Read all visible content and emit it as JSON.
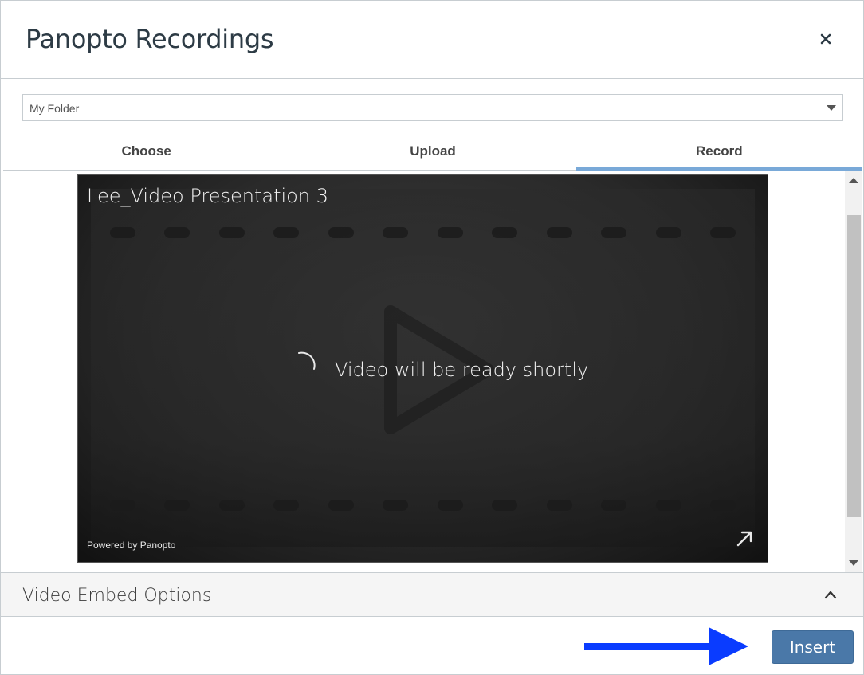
{
  "dialog": {
    "title": "Panopto Recordings",
    "close_icon": "close-icon"
  },
  "folder_select": {
    "value": "My Folder"
  },
  "tabs": [
    {
      "label": "Choose",
      "active": false
    },
    {
      "label": "Upload",
      "active": false
    },
    {
      "label": "Record",
      "active": true
    }
  ],
  "player": {
    "video_title": "Lee_Video Presentation 3",
    "status": "Video will be ready shortly",
    "powered_by": "Powered by Panopto"
  },
  "embed_options": {
    "title": "Video Embed Options"
  },
  "footer": {
    "insert_label": "Insert"
  },
  "colors": {
    "active_tab_underline": "#79a9d8",
    "insert_button": "#4a78a8",
    "annotation_arrow": "#0a3cff"
  }
}
